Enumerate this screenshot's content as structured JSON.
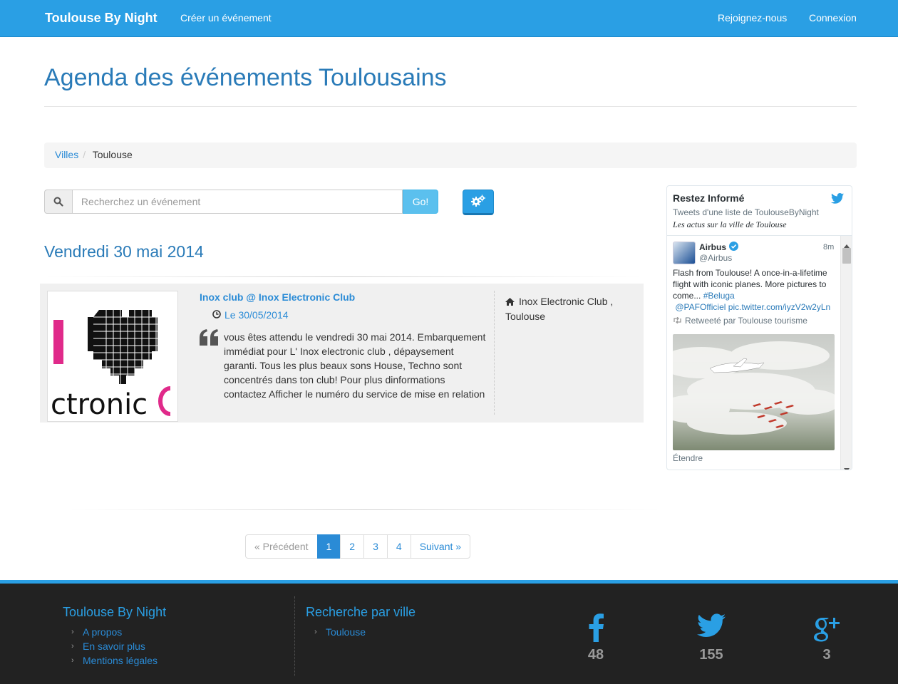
{
  "navbar": {
    "brand": "Toulouse By Night",
    "create_event": "Créer un événement",
    "join": "Rejoignez-nous",
    "login": "Connexion"
  },
  "page": {
    "title": "Agenda des événements Toulousains"
  },
  "breadcrumb": {
    "items": [
      "Villes",
      "Toulouse"
    ]
  },
  "search": {
    "placeholder": "Recherchez un événement",
    "go_label": "Go!"
  },
  "day_heading": "Vendredi 30 mai 2014",
  "event": {
    "title": "Inox club @ Inox Electronic Club",
    "date": "Le 30/05/2014",
    "description": "vous êtes attendu le vendredi 30 mai 2014. Embarquement immédiat pour L' Inox electronic club , dépaysement garanti. Tous les plus beaux sons House, Techno sont concentrés dans ton club! Pour plus dinformations contactez Afficher le numéro du service de mise en relation",
    "place": "Inox Electronic Club , Toulouse",
    "thumb_text": "ctronic"
  },
  "twitter": {
    "title": "Restez Informé",
    "subtitle": "Tweets d'une liste de ToulouseByNight",
    "description": "Les actus sur la ville de Toulouse",
    "tweet": {
      "name": "Airbus",
      "handle": "@Airbus",
      "time": "8m",
      "text": "Flash from Toulouse! A once-in-a-lifetime flight with iconic planes. More pictures to come... ",
      "hashtag": "#Beluga",
      "mention": "@PAFOfficiel",
      "link": "pic.twitter.com/iyzV2w2yLn",
      "retweet": "Retweeté par Toulouse tourisme",
      "expand": "Étendre"
    }
  },
  "pagination": {
    "prev": "« Précédent",
    "pages": [
      "1",
      "2",
      "3",
      "4"
    ],
    "active": "1",
    "next": "Suivant »"
  },
  "footer": {
    "col1_title": "Toulouse By Night",
    "col1_links": [
      "A propos",
      "En savoir plus",
      "Mentions légales"
    ],
    "col2_title": "Recherche par ville",
    "col2_links": [
      "Toulouse"
    ],
    "social": {
      "facebook_count": "48",
      "twitter_count": "155",
      "googleplus_count": "3"
    }
  },
  "colors": {
    "primary": "#2a9fe4",
    "link": "#2a8bd6",
    "footer_bg": "#222222"
  }
}
